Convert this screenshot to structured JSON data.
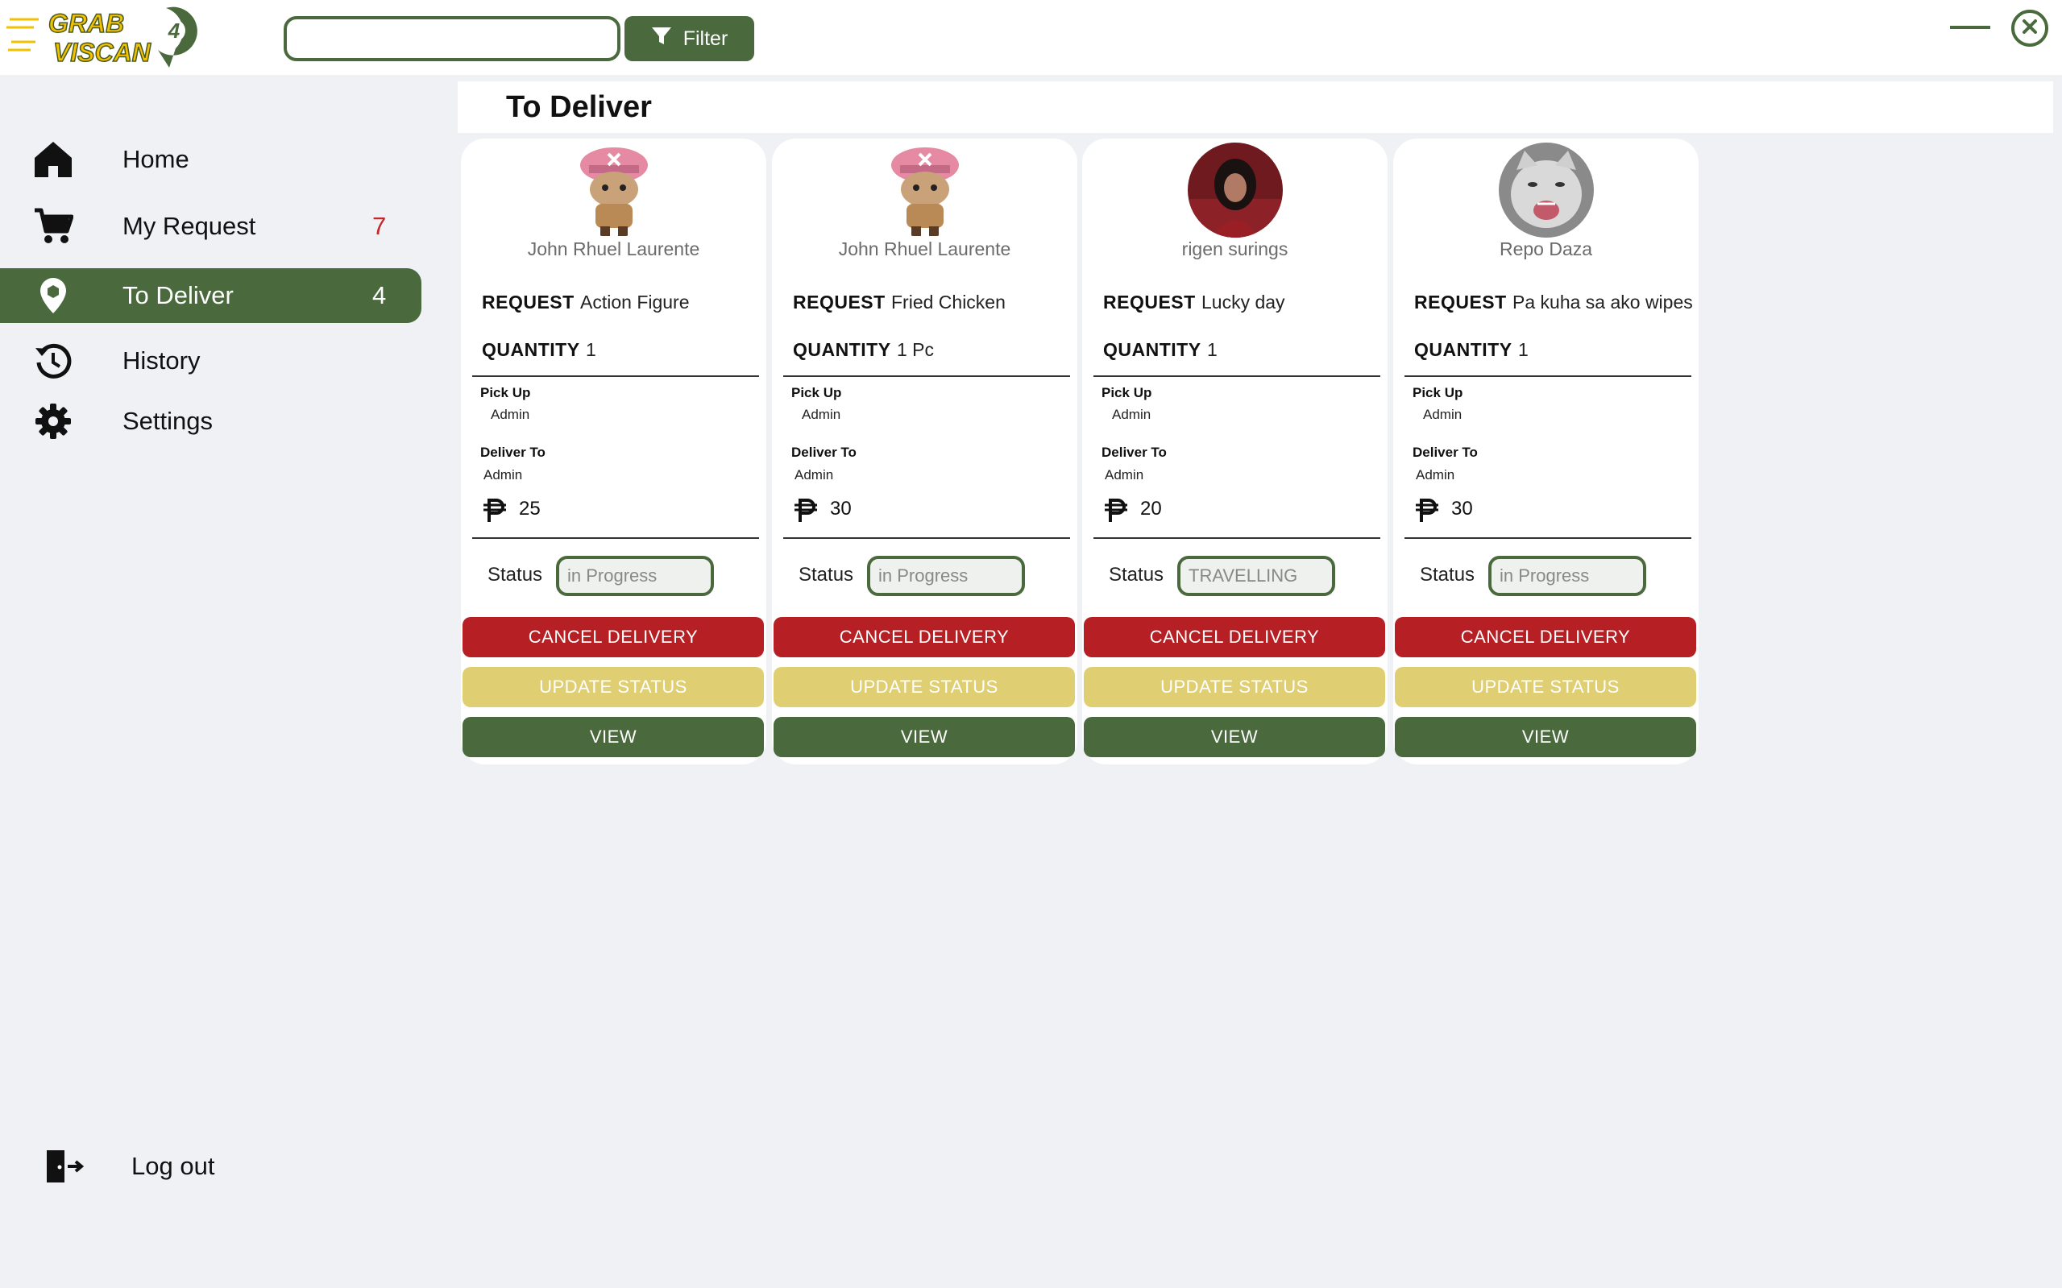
{
  "app": {
    "logo_text": "GRAB A VISCAN"
  },
  "search": {
    "value": "",
    "placeholder": ""
  },
  "filter": {
    "label": "Filter",
    "icon": "filter-icon"
  },
  "sidebar": {
    "items": [
      {
        "label": "Home",
        "icon": "home-icon",
        "count": ""
      },
      {
        "label": "My Request",
        "icon": "cart-icon",
        "count": "7"
      },
      {
        "label": "To Deliver",
        "icon": "delivery-pin-icon",
        "count": "4",
        "active": true
      },
      {
        "label": "History",
        "icon": "history-icon",
        "count": ""
      },
      {
        "label": "Settings",
        "icon": "gear-icon",
        "count": ""
      }
    ],
    "logout": {
      "label": "Log out",
      "icon": "logout-icon"
    }
  },
  "main": {
    "title": "To Deliver"
  },
  "labels": {
    "request": "REQUEST",
    "quantity": "QUANTITY",
    "pickup": "Pick Up",
    "deliver_to": "Deliver To",
    "status": "Status",
    "cancel": "CANCEL DELIVERY",
    "update": "UPDATE STATUS",
    "view": "VIEW"
  },
  "cards": [
    {
      "name": "John Rhuel Laurente",
      "request": "Action Figure",
      "quantity": "1",
      "pickup": "Admin",
      "deliver_to": "Admin",
      "price": "25",
      "status": "in Progress",
      "avatar": "chopper-avatar"
    },
    {
      "name": "John Rhuel Laurente",
      "request": "Fried Chicken",
      "quantity": "1 Pc",
      "pickup": "Admin",
      "deliver_to": "Admin",
      "price": "30",
      "status": "in Progress",
      "avatar": "chopper-avatar"
    },
    {
      "name": "rigen surings",
      "request": "Lucky day",
      "quantity": "1",
      "pickup": "Admin",
      "deliver_to": "Admin",
      "price": "20",
      "status": "TRAVELLING",
      "avatar": "person-photo-avatar"
    },
    {
      "name": "Repo Daza",
      "request": "Pa kuha sa ako wipes",
      "quantity": "1",
      "pickup": "Admin",
      "deliver_to": "Admin",
      "price": "30",
      "status": "in Progress",
      "avatar": "cat-photo-avatar"
    }
  ],
  "colors": {
    "primary": "#4a6a3e",
    "danger": "#b61f24",
    "warning": "#e0cf72",
    "count_red": "#c0282a",
    "background": "#eff1f5"
  }
}
